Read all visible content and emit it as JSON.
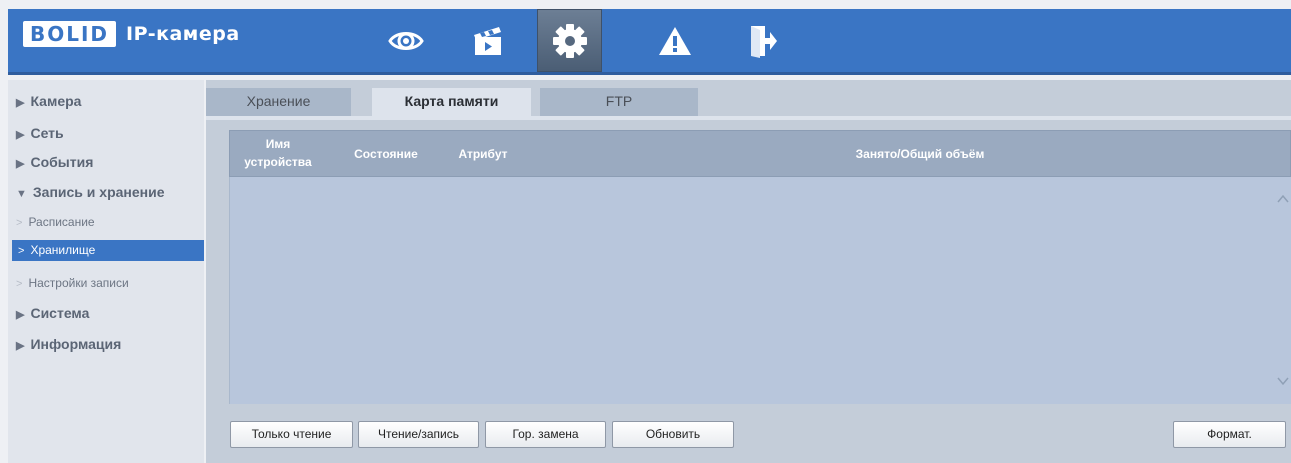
{
  "header": {
    "logo": "BOLID",
    "title": "IP-камера",
    "nav": [
      {
        "icon": "eye-icon",
        "active": false
      },
      {
        "icon": "clapperboard-icon",
        "active": false
      },
      {
        "icon": "gear-icon",
        "active": true
      },
      {
        "icon": "warning-icon",
        "active": false
      },
      {
        "icon": "logout-icon",
        "active": false
      }
    ]
  },
  "sidebar": {
    "camera": "Камера",
    "network": "Сеть",
    "events": "События",
    "storage_section": "Запись и хранение",
    "schedule": "Расписание",
    "storage": "Хранилище",
    "record_settings": "Настройки записи",
    "system": "Система",
    "info": "Информация"
  },
  "tabs": {
    "storage": "Хранение",
    "memory_card": "Карта памяти",
    "ftp": "FTP"
  },
  "table": {
    "col_device_1": "Имя",
    "col_device_2": "устройства",
    "col_state": "Состояние",
    "col_attr": "Атрибут",
    "col_space": "Занято/Общий объём",
    "rows": []
  },
  "buttons": {
    "read_only": "Только чтение",
    "read_write": "Чтение/запись",
    "hot_swap": "Гор. замена",
    "refresh": "Обновить",
    "format": "Формат."
  },
  "colors": {
    "header": "#3a75c4",
    "active_item": "#3a75c4",
    "table_header": "#9aaac0",
    "table_body": "#b8c6dc"
  }
}
